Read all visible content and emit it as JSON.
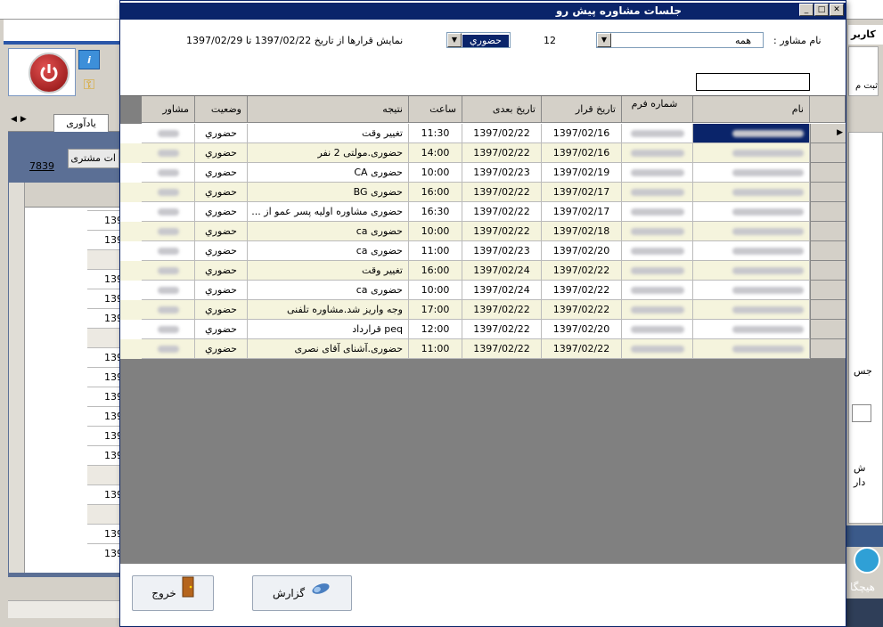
{
  "background": {
    "tab_label": "یادآوری",
    "customer_button": "ات مشتری",
    "count_link": "7839",
    "cells": [
      "139",
      "139",
      "",
      "139",
      "139",
      "139",
      "",
      "139",
      "139",
      "139",
      "139",
      "139",
      "139",
      "",
      "139",
      "",
      "139",
      "139"
    ],
    "right_top": "کاربر",
    "right_icon_label": "ثبت م",
    "right_text1": "جس",
    "right_text2a": "ش",
    "right_text2b": "دار",
    "right_bottom": "هیچگا"
  },
  "dialog": {
    "title": "جلسات مشاوره پیش رو",
    "advisor_label": "نام مشاور :",
    "advisor_value": "همه",
    "count": "12",
    "type_value": "حضوري",
    "date_range": "نمایش قرارها از تاریخ 1397/02/22 تا 1397/02/29",
    "search_value": ""
  },
  "table": {
    "headers": {
      "name": "نام",
      "form_number": "شماره فرم",
      "appointment_date": "تاریخ قرار",
      "next_date": "تاریخ بعدی",
      "time": "ساعت",
      "result": "نتیجه",
      "status": "وضعیت",
      "advisor": "مشاور"
    },
    "rows": [
      {
        "appointment_date": "1397/02/16",
        "next_date": "1397/02/22",
        "time": "11:30",
        "result": "تغییر وقت",
        "status": "حضوري"
      },
      {
        "appointment_date": "1397/02/16",
        "next_date": "1397/02/22",
        "time": "14:00",
        "result": "حضوری.مولتی  2 نفر",
        "status": "حضوري"
      },
      {
        "appointment_date": "1397/02/19",
        "next_date": "1397/02/23",
        "time": "10:00",
        "result": "حضوری CA",
        "status": "حضوري"
      },
      {
        "appointment_date": "1397/02/17",
        "next_date": "1397/02/22",
        "time": "16:00",
        "result": "حضوری BG",
        "status": "حضوري"
      },
      {
        "appointment_date": "1397/02/17",
        "next_date": "1397/02/22",
        "time": "16:30",
        "result": "حضوری مشاوره اولیه پسر عمو از ...",
        "status": "حضوري"
      },
      {
        "appointment_date": "1397/02/18",
        "next_date": "1397/02/22",
        "time": "10:00",
        "result": "حضوری ca",
        "status": "حضوري"
      },
      {
        "appointment_date": "1397/02/20",
        "next_date": "1397/02/23",
        "time": "11:00",
        "result": "حضوری ca",
        "status": "حضوري"
      },
      {
        "appointment_date": "1397/02/22",
        "next_date": "1397/02/24",
        "time": "16:00",
        "result": "تغییر وقت",
        "status": "حضوري"
      },
      {
        "appointment_date": "1397/02/22",
        "next_date": "1397/02/24",
        "time": "10:00",
        "result": "حضوری ca",
        "status": "حضوري"
      },
      {
        "appointment_date": "1397/02/22",
        "next_date": "1397/02/22",
        "time": "17:00",
        "result": "وجه واریز شد.مشاوره تلفنی",
        "status": "حضوري"
      },
      {
        "appointment_date": "1397/02/20",
        "next_date": "1397/02/22",
        "time": "12:00",
        "result": "peq قرارداد",
        "status": "حضوري"
      },
      {
        "appointment_date": "1397/02/22",
        "next_date": "1397/02/22",
        "time": "11:00",
        "result": "حضوری.آشنای آقای نصری",
        "status": "حضوري"
      }
    ]
  },
  "buttons": {
    "report": "گزارش",
    "exit": "خروج"
  }
}
